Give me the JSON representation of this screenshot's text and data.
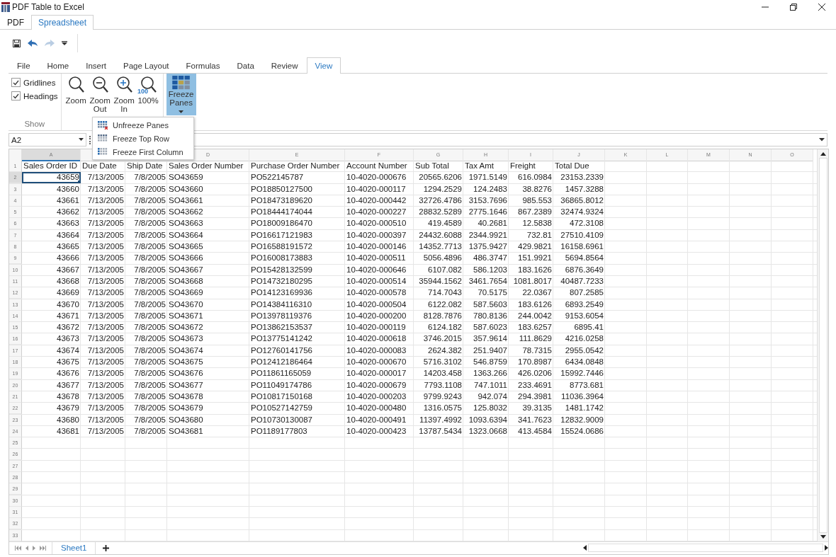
{
  "window": {
    "title": "PDF Table to Excel"
  },
  "app_tabs": [
    {
      "label": "PDF",
      "selected": false
    },
    {
      "label": "Spreadsheet",
      "selected": true
    }
  ],
  "ribbon_tabs": [
    {
      "label": "File",
      "selected": false
    },
    {
      "label": "Home",
      "selected": false
    },
    {
      "label": "Insert",
      "selected": false
    },
    {
      "label": "Page Layout",
      "selected": false
    },
    {
      "label": "Formulas",
      "selected": false
    },
    {
      "label": "Data",
      "selected": false
    },
    {
      "label": "Review",
      "selected": false
    },
    {
      "label": "View",
      "selected": true
    }
  ],
  "ribbon": {
    "show_group": {
      "label": "Show",
      "options": [
        {
          "label": "Gridlines",
          "checked": true
        },
        {
          "label": "Headings",
          "checked": true
        }
      ]
    },
    "zoom_buttons": [
      {
        "label": "Zoom",
        "kind": "zoom"
      },
      {
        "label": "Zoom Out",
        "kind": "zoom_out"
      },
      {
        "label": "Zoom In",
        "kind": "zoom_in"
      },
      {
        "label": "100%",
        "kind": "zoom_100",
        "badge": "100"
      }
    ],
    "freeze_button": {
      "label": "Freeze Panes",
      "selected": true
    }
  },
  "freeze_menu": [
    {
      "label": "Unfreeze Panes",
      "kind": "unfreeze"
    },
    {
      "label": "Freeze Top Row",
      "kind": "top_row"
    },
    {
      "label": "Freeze First Column",
      "kind": "first_column"
    }
  ],
  "name_box": {
    "value": "A2"
  },
  "sheet": {
    "columns": [
      {
        "letter": "A",
        "kind": "number",
        "selected": true
      },
      {
        "kind": "number",
        "selected": false
      },
      {
        "kind": "number",
        "selected": false
      },
      {
        "letter": "D",
        "kind": "text",
        "selected": false
      },
      {
        "letter": "E",
        "kind": "text",
        "selected": false
      },
      {
        "letter": "F",
        "kind": "text",
        "selected": false
      },
      {
        "letter": "G",
        "kind": "number",
        "selected": false
      },
      {
        "letter": "H",
        "kind": "number",
        "selected": false
      },
      {
        "letter": "I",
        "kind": "number",
        "selected": false
      },
      {
        "letter": "J",
        "kind": "number",
        "selected": false
      },
      {
        "letter": "K",
        "kind": "text",
        "selected": false
      },
      {
        "letter": "L",
        "kind": "text",
        "selected": false
      },
      {
        "letter": "M",
        "kind": "text",
        "selected": false
      },
      {
        "letter": "N",
        "kind": "text",
        "selected": false
      },
      {
        "letter": "O",
        "kind": "text",
        "selected": false
      }
    ],
    "rows": [
      {
        "number": "1",
        "kind": "header",
        "selected": false,
        "cells": [
          "Sales Order ID",
          "Due Date",
          "Ship Date",
          "Sales Order Number",
          "Purchase Order Number",
          "Account Number",
          "Sub Total",
          "Tax Amt",
          "Freight",
          "Total Due"
        ]
      },
      {
        "number": "2",
        "kind": "data",
        "selected": true,
        "cells": [
          "43659",
          "7/13/2005",
          "7/8/2005",
          "SO43659",
          "PO522145787",
          "10-4020-000676",
          "20565.6206",
          "1971.5149",
          "616.0984",
          "23153.2339"
        ]
      },
      {
        "number": "3",
        "kind": "data",
        "selected": false,
        "cells": [
          "43660",
          "7/13/2005",
          "7/8/2005",
          "SO43660",
          "PO18850127500",
          "10-4020-000117",
          "1294.2529",
          "124.2483",
          "38.8276",
          "1457.3288"
        ]
      },
      {
        "number": "4",
        "kind": "data",
        "selected": false,
        "cells": [
          "43661",
          "7/13/2005",
          "7/8/2005",
          "SO43661",
          "PO18473189620",
          "10-4020-000442",
          "32726.4786",
          "3153.7696",
          "985.553",
          "36865.8012"
        ]
      },
      {
        "number": "5",
        "kind": "data",
        "selected": false,
        "cells": [
          "43662",
          "7/13/2005",
          "7/8/2005",
          "SO43662",
          "PO18444174044",
          "10-4020-000227",
          "28832.5289",
          "2775.1646",
          "867.2389",
          "32474.9324"
        ]
      },
      {
        "number": "6",
        "kind": "data",
        "selected": false,
        "cells": [
          "43663",
          "7/13/2005",
          "7/8/2005",
          "SO43663",
          "PO18009186470",
          "10-4020-000510",
          "419.4589",
          "40.2681",
          "12.5838",
          "472.3108"
        ]
      },
      {
        "number": "7",
        "kind": "data",
        "selected": false,
        "cells": [
          "43664",
          "7/13/2005",
          "7/8/2005",
          "SO43664",
          "PO16617121983",
          "10-4020-000397",
          "24432.6088",
          "2344.9921",
          "732.81",
          "27510.4109"
        ]
      },
      {
        "number": "8",
        "kind": "data",
        "selected": false,
        "cells": [
          "43665",
          "7/13/2005",
          "7/8/2005",
          "SO43665",
          "PO16588191572",
          "10-4020-000146",
          "14352.7713",
          "1375.9427",
          "429.9821",
          "16158.6961"
        ]
      },
      {
        "number": "9",
        "kind": "data",
        "selected": false,
        "cells": [
          "43666",
          "7/13/2005",
          "7/8/2005",
          "SO43666",
          "PO16008173883",
          "10-4020-000511",
          "5056.4896",
          "486.3747",
          "151.9921",
          "5694.8564"
        ]
      },
      {
        "number": "10",
        "kind": "data",
        "selected": false,
        "cells": [
          "43667",
          "7/13/2005",
          "7/8/2005",
          "SO43667",
          "PO15428132599",
          "10-4020-000646",
          "6107.082",
          "586.1203",
          "183.1626",
          "6876.3649"
        ]
      },
      {
        "number": "11",
        "kind": "data",
        "selected": false,
        "cells": [
          "43668",
          "7/13/2005",
          "7/8/2005",
          "SO43668",
          "PO14732180295",
          "10-4020-000514",
          "35944.1562",
          "3461.7654",
          "1081.8017",
          "40487.7233"
        ]
      },
      {
        "number": "12",
        "kind": "data",
        "selected": false,
        "cells": [
          "43669",
          "7/13/2005",
          "7/8/2005",
          "SO43669",
          "PO14123169936",
          "10-4020-000578",
          "714.7043",
          "70.5175",
          "22.0367",
          "807.2585"
        ]
      },
      {
        "number": "13",
        "kind": "data",
        "selected": false,
        "cells": [
          "43670",
          "7/13/2005",
          "7/8/2005",
          "SO43670",
          "PO14384116310",
          "10-4020-000504",
          "6122.082",
          "587.5603",
          "183.6126",
          "6893.2549"
        ]
      },
      {
        "number": "14",
        "kind": "data",
        "selected": false,
        "cells": [
          "43671",
          "7/13/2005",
          "7/8/2005",
          "SO43671",
          "PO13978119376",
          "10-4020-000200",
          "8128.7876",
          "780.8136",
          "244.0042",
          "9153.6054"
        ]
      },
      {
        "number": "15",
        "kind": "data",
        "selected": false,
        "cells": [
          "43672",
          "7/13/2005",
          "7/8/2005",
          "SO43672",
          "PO13862153537",
          "10-4020-000119",
          "6124.182",
          "587.6023",
          "183.6257",
          "6895.41"
        ]
      },
      {
        "number": "16",
        "kind": "data",
        "selected": false,
        "cells": [
          "43673",
          "7/13/2005",
          "7/8/2005",
          "SO43673",
          "PO13775141242",
          "10-4020-000618",
          "3746.2015",
          "357.9614",
          "111.8629",
          "4216.0258"
        ]
      },
      {
        "number": "17",
        "kind": "data",
        "selected": false,
        "cells": [
          "43674",
          "7/13/2005",
          "7/8/2005",
          "SO43674",
          "PO12760141756",
          "10-4020-000083",
          "2624.382",
          "251.9407",
          "78.7315",
          "2955.0542"
        ]
      },
      {
        "number": "18",
        "kind": "data",
        "selected": false,
        "cells": [
          "43675",
          "7/13/2005",
          "7/8/2005",
          "SO43675",
          "PO12412186464",
          "10-4020-000670",
          "5716.3102",
          "546.8759",
          "170.8987",
          "6434.0848"
        ]
      },
      {
        "number": "19",
        "kind": "data",
        "selected": false,
        "cells": [
          "43676",
          "7/13/2005",
          "7/8/2005",
          "SO43676",
          "PO11861165059",
          "10-4020-000017",
          "14203.458",
          "1363.266",
          "426.0206",
          "15992.7446"
        ]
      },
      {
        "number": "20",
        "kind": "data",
        "selected": false,
        "cells": [
          "43677",
          "7/13/2005",
          "7/8/2005",
          "SO43677",
          "PO11049174786",
          "10-4020-000679",
          "7793.1108",
          "747.1011",
          "233.4691",
          "8773.681"
        ]
      },
      {
        "number": "21",
        "kind": "data",
        "selected": false,
        "cells": [
          "43678",
          "7/13/2005",
          "7/8/2005",
          "SO43678",
          "PO10817150168",
          "10-4020-000203",
          "9799.9243",
          "942.074",
          "294.3981",
          "11036.3964"
        ]
      },
      {
        "number": "22",
        "kind": "data",
        "selected": false,
        "cells": [
          "43679",
          "7/13/2005",
          "7/8/2005",
          "SO43679",
          "PO10527142759",
          "10-4020-000480",
          "1316.0575",
          "125.8032",
          "39.3135",
          "1481.1742"
        ]
      },
      {
        "number": "23",
        "kind": "data",
        "selected": false,
        "cells": [
          "43680",
          "7/13/2005",
          "7/8/2005",
          "SO43680",
          "PO10730130087",
          "10-4020-000491",
          "11397.4992",
          "1093.6394",
          "341.7623",
          "12832.9009"
        ]
      },
      {
        "number": "24",
        "kind": "data",
        "selected": false,
        "cells": [
          "43681",
          "7/13/2005",
          "7/8/2005",
          "SO43681",
          "PO1189177803",
          "10-4020-000423",
          "13787.5434",
          "1323.0668",
          "413.4584",
          "15524.0686"
        ]
      },
      {
        "number": "25",
        "kind": "data",
        "selected": false
      },
      {
        "number": "26",
        "kind": "data",
        "selected": false
      },
      {
        "number": "27",
        "kind": "data",
        "selected": false
      },
      {
        "number": "28",
        "kind": "data",
        "selected": false
      },
      {
        "number": "29",
        "kind": "data",
        "selected": false
      },
      {
        "number": "30",
        "kind": "data",
        "selected": false
      },
      {
        "number": "31",
        "kind": "data",
        "selected": false
      },
      {
        "number": "32",
        "kind": "data",
        "selected": false
      },
      {
        "number": "33",
        "kind": "data",
        "selected": false
      }
    ]
  },
  "sheet_tabs": [
    {
      "label": "Sheet1",
      "selected": true
    }
  ]
}
